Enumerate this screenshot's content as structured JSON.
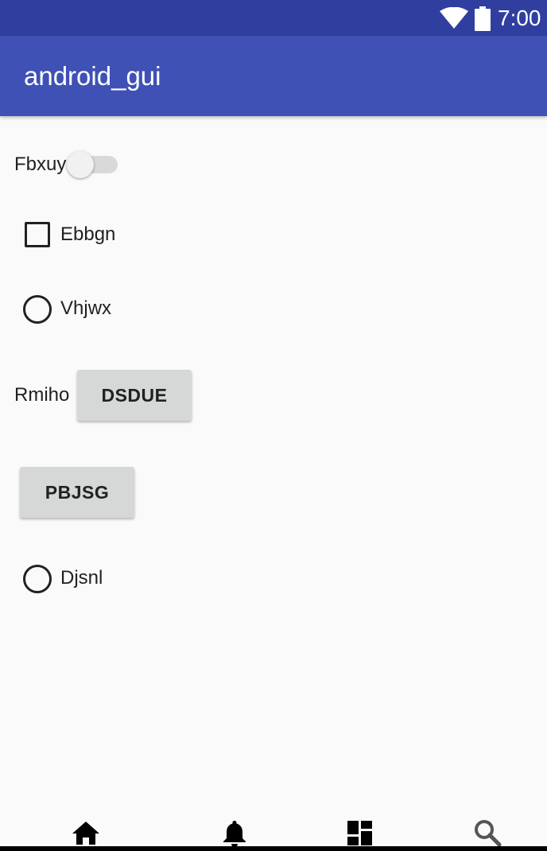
{
  "status_bar": {
    "time": "7:00",
    "icons": [
      "wifi-icon",
      "battery-icon"
    ],
    "background": "#303f9f"
  },
  "app_bar": {
    "title": "android_gui",
    "background": "#3f51b5"
  },
  "content": {
    "switch_row": {
      "label": "Fbxuy",
      "checked": false
    },
    "checkbox_row": {
      "label": "Ebbgn",
      "checked": false
    },
    "radio_row_1": {
      "label": "Vhjwx",
      "selected": false
    },
    "button_row": {
      "label": "Rmiho",
      "button_label": "DSDUE"
    },
    "standalone_button": {
      "label": "PBJSG"
    },
    "radio_row_2": {
      "label": "Djsnl",
      "selected": false
    }
  },
  "bottom_nav": {
    "items": [
      {
        "icon": "home-icon"
      },
      {
        "icon": "bell-icon"
      },
      {
        "icon": "dashboard-icon"
      },
      {
        "icon": "search-icon"
      }
    ]
  },
  "colors": {
    "background": "#fafafa",
    "text": "#212121",
    "button": "#d6d7d7"
  }
}
